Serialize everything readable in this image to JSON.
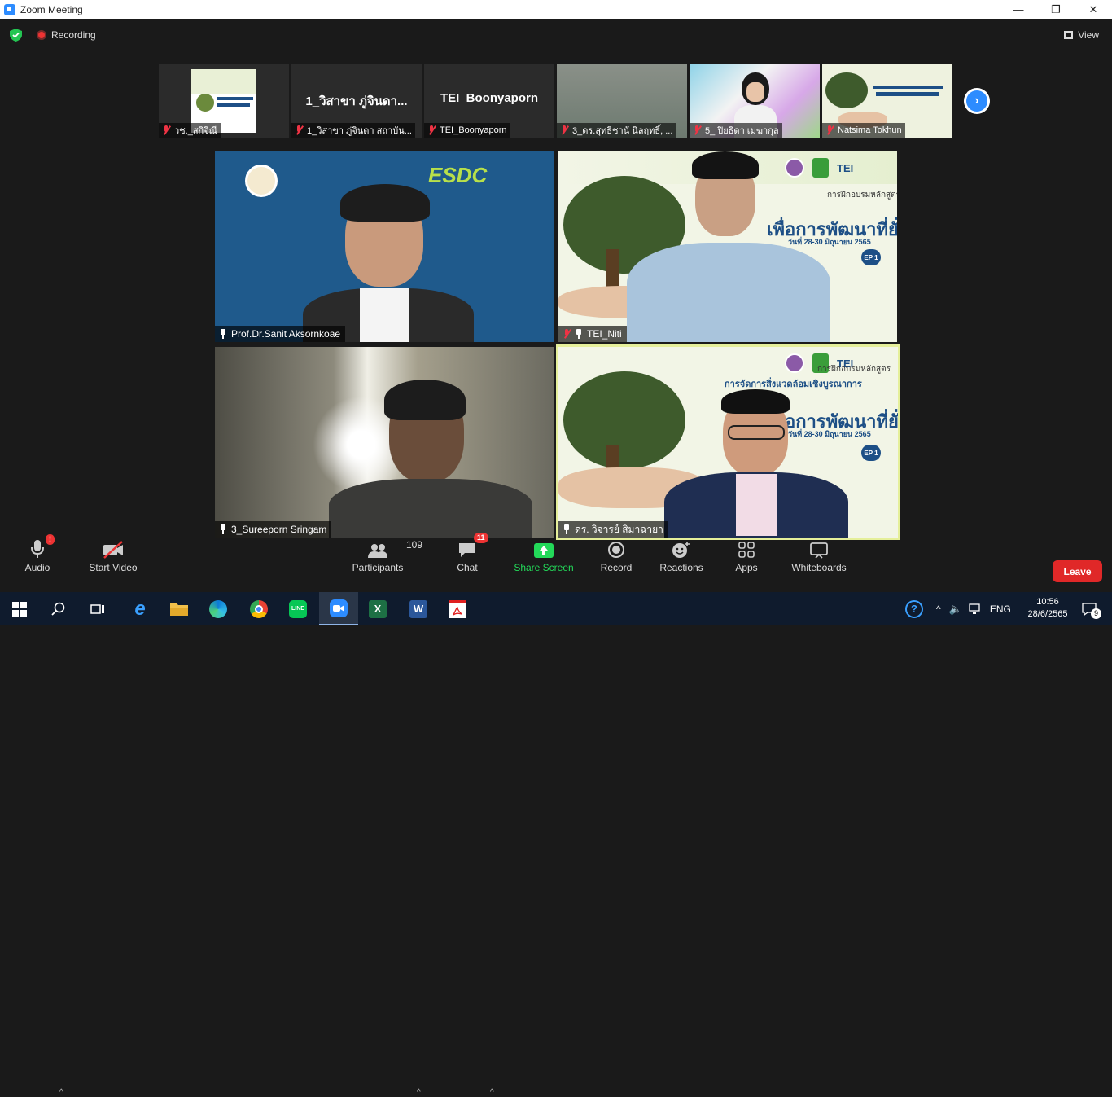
{
  "window": {
    "title": "Zoom Meeting",
    "controls": [
      "minimize",
      "restore",
      "close"
    ]
  },
  "topbar": {
    "recording_label": "Recording",
    "view_label": "View"
  },
  "thumbnails": [
    {
      "name": "วช._สกิจิณี",
      "muted": true,
      "content": "slide"
    },
    {
      "name": "1_วิสาขา ภู่จินดา สถาบัน...",
      "muted": true,
      "big_name": "1_วิสาขา ภู่จินดา..."
    },
    {
      "name": "TEI_Boonyaporn",
      "muted": true,
      "big_name": "TEI_Boonyaporn"
    },
    {
      "name": "3_ดร.สุทธิชานั นิลฤทธิ์, ...",
      "muted": true,
      "content": "blurred"
    },
    {
      "name": "5_ ปิยธิดา เมฆากุล",
      "muted": true,
      "content": "video"
    },
    {
      "name": "Natsima Tokhun",
      "muted": true,
      "content": "slide"
    }
  ],
  "gallery": [
    {
      "name": "Prof.Dr.Sanit Aksornkoae",
      "muted": false,
      "pinned": true,
      "logo_text": "ESDC"
    },
    {
      "name": "TEI_Niti",
      "muted": true,
      "pinned": true
    },
    {
      "name": "3_Sureeporn Sringam",
      "muted": false,
      "pinned": true
    },
    {
      "name": "ดร. วิจารย์ สิมาฉายา",
      "muted": false,
      "pinned": true,
      "active_speaker": true
    }
  ],
  "banner": {
    "small_line": "การฝึกอบรมหลักสูตร",
    "line1": "การจัดการสิ่งแวดล้อมเชิงบูรณาการ",
    "line2": "เพื่อการพัฒนาที่ยั่งยืน",
    "date": "วันที่ 28-30 มิถุนายน 2565",
    "ep": "EP 1",
    "tei": "TEI"
  },
  "toolbar": {
    "audio": {
      "label": "Audio",
      "badge": "!"
    },
    "video": {
      "label": "Start Video"
    },
    "participants": {
      "label": "Participants",
      "count": "109"
    },
    "chat": {
      "label": "Chat",
      "badge": "11"
    },
    "share": {
      "label": "Share Screen"
    },
    "record": {
      "label": "Record"
    },
    "reactions": {
      "label": "Reactions"
    },
    "apps": {
      "label": "Apps"
    },
    "whiteboards": {
      "label": "Whiteboards"
    },
    "leave": {
      "label": "Leave"
    }
  },
  "taskbar": {
    "apps": [
      "start",
      "search",
      "task-view",
      "internet-explorer",
      "file-explorer",
      "edge",
      "chrome",
      "line",
      "zoom",
      "excel",
      "word",
      "acrobat"
    ],
    "language": "ENG",
    "time": "10:56",
    "date": "28/6/2565",
    "notifications": "9"
  },
  "colors": {
    "zoom_blue": "#2d8cff",
    "leave_red": "#e02828",
    "share_green": "#23d959",
    "active_border": "#e5ef9a"
  }
}
